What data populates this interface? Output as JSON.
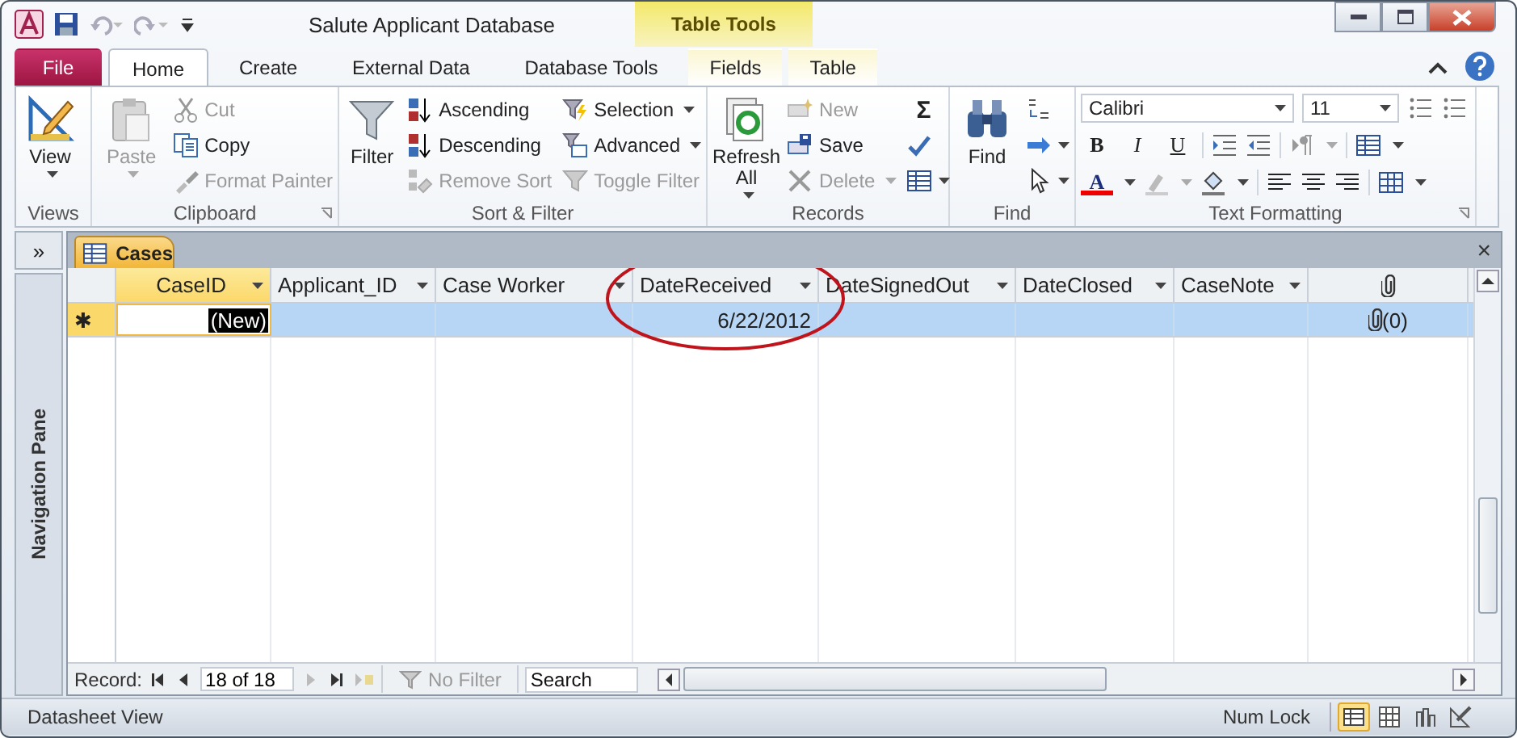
{
  "window": {
    "title": "Salute Applicant Database",
    "contextual_label": "Table Tools"
  },
  "ribbon_tabs": [
    {
      "label": "File",
      "kind": "file",
      "selected": false
    },
    {
      "label": "Home",
      "kind": "tab",
      "selected": true
    },
    {
      "label": "Create",
      "kind": "tab",
      "selected": false
    },
    {
      "label": "External Data",
      "kind": "tab",
      "selected": false
    },
    {
      "label": "Database Tools",
      "kind": "tab",
      "selected": false
    },
    {
      "label": "Fields",
      "kind": "contextual",
      "selected": false
    },
    {
      "label": "Table",
      "kind": "contextual",
      "selected": false
    }
  ],
  "groups": [
    {
      "label": "Views",
      "kind": "standard",
      "launcher": false,
      "items": [
        {
          "label": "View",
          "kind": "large",
          "disabled": false,
          "dropdown": true
        }
      ]
    },
    {
      "label": "Clipboard",
      "kind": "standard",
      "launcher": true,
      "items": [
        {
          "label": "Paste",
          "kind": "large",
          "disabled": true,
          "dropdown": true
        },
        {
          "label": "Cut",
          "kind": "small",
          "disabled": true,
          "dropdown": false
        },
        {
          "label": "Copy",
          "kind": "small",
          "disabled": false,
          "dropdown": false
        },
        {
          "label": "Format Painter",
          "kind": "small",
          "disabled": true,
          "dropdown": false
        }
      ]
    },
    {
      "label": "Sort & Filter",
      "kind": "standard",
      "launcher": false,
      "items": [
        {
          "label": "Filter",
          "kind": "large",
          "disabled": false,
          "dropdown": false
        },
        {
          "label": "Ascending",
          "kind": "small",
          "disabled": false,
          "dropdown": false
        },
        {
          "label": "Descending",
          "kind": "small",
          "disabled": false,
          "dropdown": false
        },
        {
          "label": "Remove Sort",
          "kind": "small",
          "disabled": true,
          "dropdown": false
        },
        {
          "label": "Selection",
          "kind": "small",
          "disabled": false,
          "dropdown": true
        },
        {
          "label": "Advanced",
          "kind": "small",
          "disabled": false,
          "dropdown": true
        },
        {
          "label": "Toggle Filter",
          "kind": "small",
          "disabled": true,
          "dropdown": false
        }
      ]
    },
    {
      "label": "Records",
      "kind": "records",
      "launcher": false,
      "items": [
        {
          "label": "Refresh All",
          "kind": "large",
          "disabled": false,
          "dropdown": true
        },
        {
          "label": "New",
          "kind": "small",
          "disabled": true,
          "dropdown": false
        },
        {
          "label": "Save",
          "kind": "small",
          "disabled": false,
          "dropdown": false
        },
        {
          "label": "Delete",
          "kind": "small",
          "disabled": true,
          "dropdown": true
        },
        {
          "label": "Σ",
          "kind": "glyph",
          "disabled": false
        }
      ]
    },
    {
      "label": "Find",
      "kind": "find",
      "launcher": false,
      "items": [
        {
          "label": "Find",
          "kind": "large",
          "disabled": false,
          "dropdown": false
        }
      ]
    },
    {
      "label": "Text Formatting",
      "kind": "text",
      "launcher": true,
      "font": "Calibri",
      "size": "11",
      "items": [
        {
          "label": "B",
          "kind": "bold"
        },
        {
          "label": "I",
          "kind": "italic"
        },
        {
          "label": "U",
          "kind": "underline"
        },
        {
          "label": "A",
          "kind": "font-color"
        }
      ]
    }
  ],
  "nav_pane": {
    "label": "Navigation Pane",
    "toggle": "»"
  },
  "document": {
    "tab": "Cases",
    "close": "×"
  },
  "datasheet": {
    "columns": [
      {
        "label": "CaseID",
        "kind": "field",
        "selected": true
      },
      {
        "label": "Applicant_ID",
        "kind": "field",
        "selected": false
      },
      {
        "label": "Case Worker",
        "kind": "field",
        "selected": false
      },
      {
        "label": "DateReceived",
        "kind": "field",
        "selected": false
      },
      {
        "label": "DateSignedOut",
        "kind": "field",
        "selected": false
      },
      {
        "label": "DateClosed",
        "kind": "field",
        "selected": false
      },
      {
        "label": "CaseNote",
        "kind": "field",
        "selected": false
      },
      {
        "kind": "attachment",
        "selected": false
      }
    ],
    "rows": [
      {
        "marker": "✱",
        "selected": true,
        "cells": [
          "(New)",
          null,
          null,
          "6/22/2012",
          null,
          null,
          null,
          "(0)"
        ]
      }
    ]
  },
  "record_nav": {
    "label": "Record:",
    "position": "18 of 18",
    "filter": "No Filter",
    "filter_active": false,
    "search_placeholder": "Search"
  },
  "status_bar": {
    "text": "Datasheet View",
    "indicators": [
      "Num Lock"
    ],
    "views": [
      {
        "selected": true
      },
      {
        "selected": false
      },
      {
        "selected": false
      },
      {
        "selected": false
      }
    ]
  }
}
